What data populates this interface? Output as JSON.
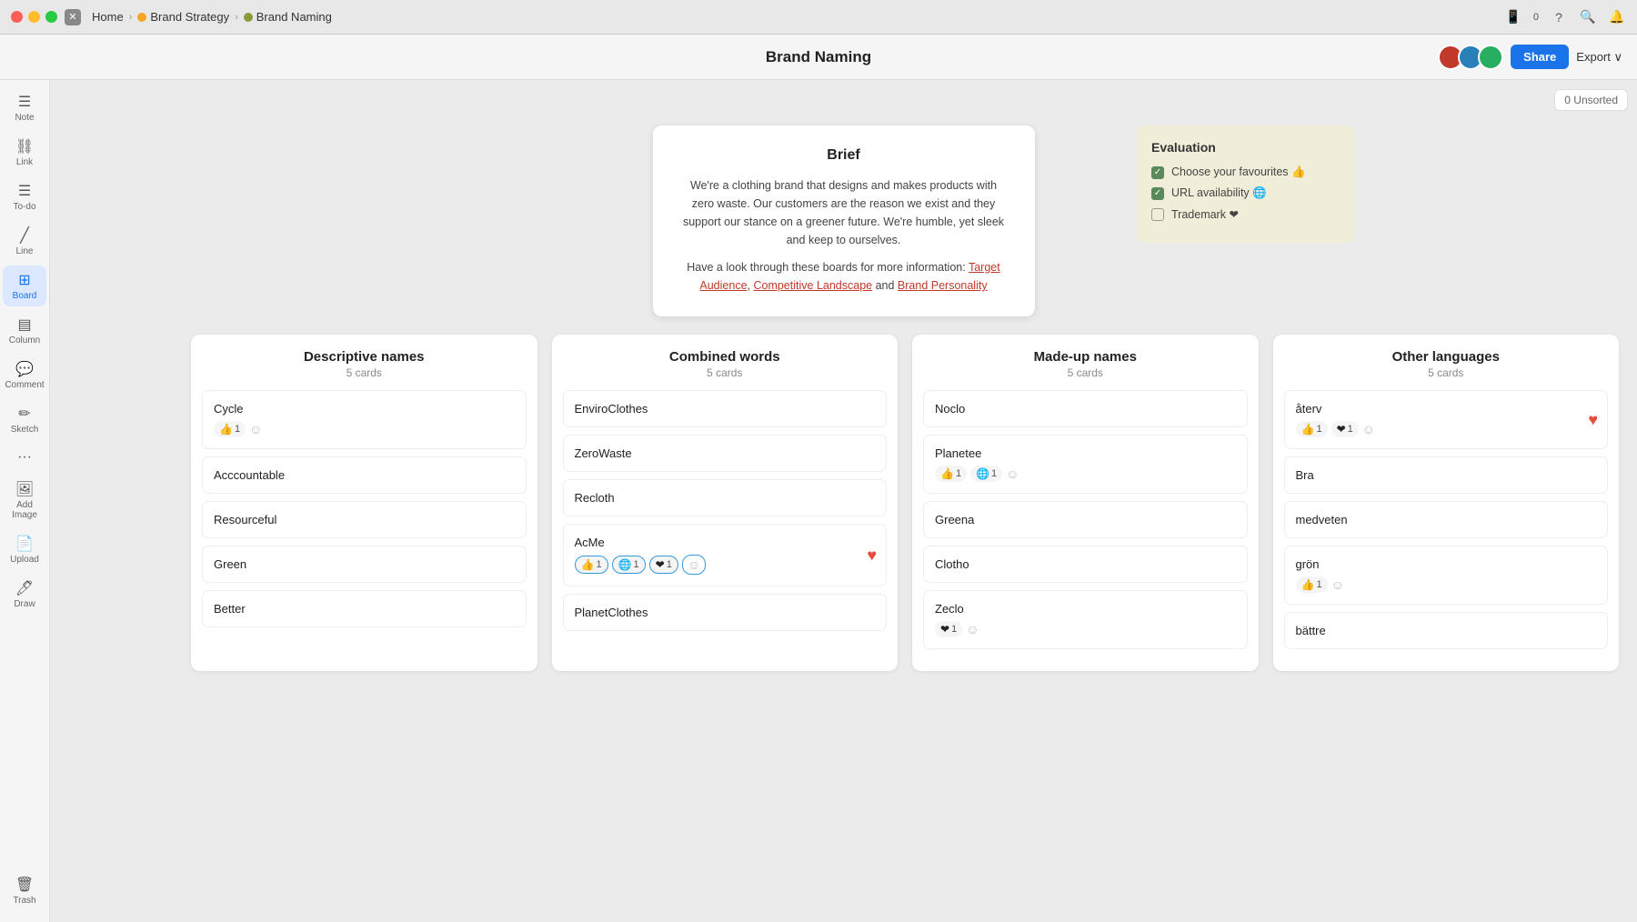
{
  "titleBar": {
    "home": "Home",
    "breadcrumbs": [
      {
        "label": "Brand Strategy",
        "color": "bc-orange"
      },
      {
        "label": "Brand Naming",
        "color": "bc-olive"
      }
    ]
  },
  "header": {
    "title": "Brand Naming",
    "shareLabel": "Share",
    "exportLabel": "Export ∨"
  },
  "sidebar": {
    "items": [
      {
        "id": "note",
        "icon": "☰",
        "label": "Note"
      },
      {
        "id": "link",
        "icon": "🔗",
        "label": "Link"
      },
      {
        "id": "todo",
        "icon": "☰",
        "label": "To-do"
      },
      {
        "id": "line",
        "icon": "╱",
        "label": "Line"
      },
      {
        "id": "board",
        "icon": "⊞",
        "label": "Board",
        "active": true
      },
      {
        "id": "column",
        "icon": "▤",
        "label": "Column"
      },
      {
        "id": "comment",
        "icon": "💬",
        "label": "Comment"
      },
      {
        "id": "sketch",
        "icon": "✏",
        "label": "Sketch"
      },
      {
        "id": "more",
        "icon": "•••",
        "label": ""
      },
      {
        "id": "addimage",
        "icon": "🖼",
        "label": "Add Image"
      },
      {
        "id": "upload",
        "icon": "📄",
        "label": "Upload"
      },
      {
        "id": "draw",
        "icon": "🖊",
        "label": "Draw"
      }
    ],
    "trashLabel": "Trash"
  },
  "unsorted": "0 Unsorted",
  "brief": {
    "title": "Brief",
    "paragraph1": "We're a clothing brand that designs and makes products with zero waste. Our customers are the reason we exist and they support our stance on a greener future. We're humble, yet sleek and keep to ourselves.",
    "paragraph2Start": "Have a look through these boards for more information: ",
    "links": [
      "Target Audience",
      "Competitive Landscape",
      "Brand Personality"
    ],
    "linkSep1": ", ",
    "linkSep2": " and "
  },
  "evaluation": {
    "title": "Evaluation",
    "items": [
      {
        "label": "Choose your favourites 👍",
        "checked": true
      },
      {
        "label": "URL availability 🌐",
        "checked": true
      },
      {
        "label": "Trademark ❤",
        "checked": false
      }
    ]
  },
  "columns": [
    {
      "id": "descriptive",
      "title": "Descriptive names",
      "count": "5 cards",
      "cards": [
        {
          "text": "Cycle",
          "reactions": [
            {
              "emoji": "👍",
              "count": "1"
            },
            {
              "emoji": "😊",
              "count": null
            }
          ],
          "heart": false
        },
        {
          "text": "Acccountable",
          "reactions": [],
          "heart": false
        },
        {
          "text": "Resourceful",
          "reactions": [],
          "heart": false
        },
        {
          "text": "Green",
          "reactions": [],
          "heart": false
        },
        {
          "text": "Better",
          "reactions": [],
          "heart": false
        }
      ]
    },
    {
      "id": "combined",
      "title": "Combined words",
      "count": "5 cards",
      "cards": [
        {
          "text": "EnviroClothes",
          "reactions": [],
          "heart": false
        },
        {
          "text": "ZeroWaste",
          "reactions": [],
          "heart": false
        },
        {
          "text": "Recloth",
          "reactions": [],
          "heart": false
        },
        {
          "text": "AcMe",
          "reactions": [
            {
              "emoji": "👍",
              "count": "1"
            },
            {
              "emoji": "🌐",
              "count": "1"
            },
            {
              "emoji": "❤",
              "count": "1"
            },
            {
              "emoji": "😊",
              "count": null
            }
          ],
          "heart": true,
          "highlighted": true
        },
        {
          "text": "PlanetClothes",
          "reactions": [],
          "heart": false
        }
      ]
    },
    {
      "id": "madeup",
      "title": "Made-up names",
      "count": "5 cards",
      "cards": [
        {
          "text": "Noclo",
          "reactions": [],
          "heart": false
        },
        {
          "text": "Planetee",
          "reactions": [
            {
              "emoji": "👍",
              "count": "1"
            },
            {
              "emoji": "🌐",
              "count": "1"
            },
            {
              "emoji": "😊",
              "count": null
            }
          ],
          "heart": false
        },
        {
          "text": "Greena",
          "reactions": [],
          "heart": false
        },
        {
          "text": "Clotho",
          "reactions": [],
          "heart": false
        },
        {
          "text": "Zeclo",
          "reactions": [
            {
              "emoji": "❤",
              "count": "1"
            },
            {
              "emoji": "😊",
              "count": null
            }
          ],
          "heart": false
        }
      ]
    },
    {
      "id": "languages",
      "title": "Other languages",
      "count": "5 cards",
      "cards": [
        {
          "text": "återv",
          "reactions": [
            {
              "emoji": "👍",
              "count": "1"
            },
            {
              "emoji": "❤",
              "count": "1"
            },
            {
              "emoji": "😊",
              "count": null
            }
          ],
          "heart": true
        },
        {
          "text": "Bra",
          "reactions": [],
          "heart": false
        },
        {
          "text": "medveten",
          "reactions": [],
          "heart": false
        },
        {
          "text": "grön",
          "reactions": [
            {
              "emoji": "👍",
              "count": "1"
            },
            {
              "emoji": "😊",
              "count": null
            }
          ],
          "heart": false
        },
        {
          "text": "bättre",
          "reactions": [],
          "heart": false
        }
      ]
    }
  ]
}
